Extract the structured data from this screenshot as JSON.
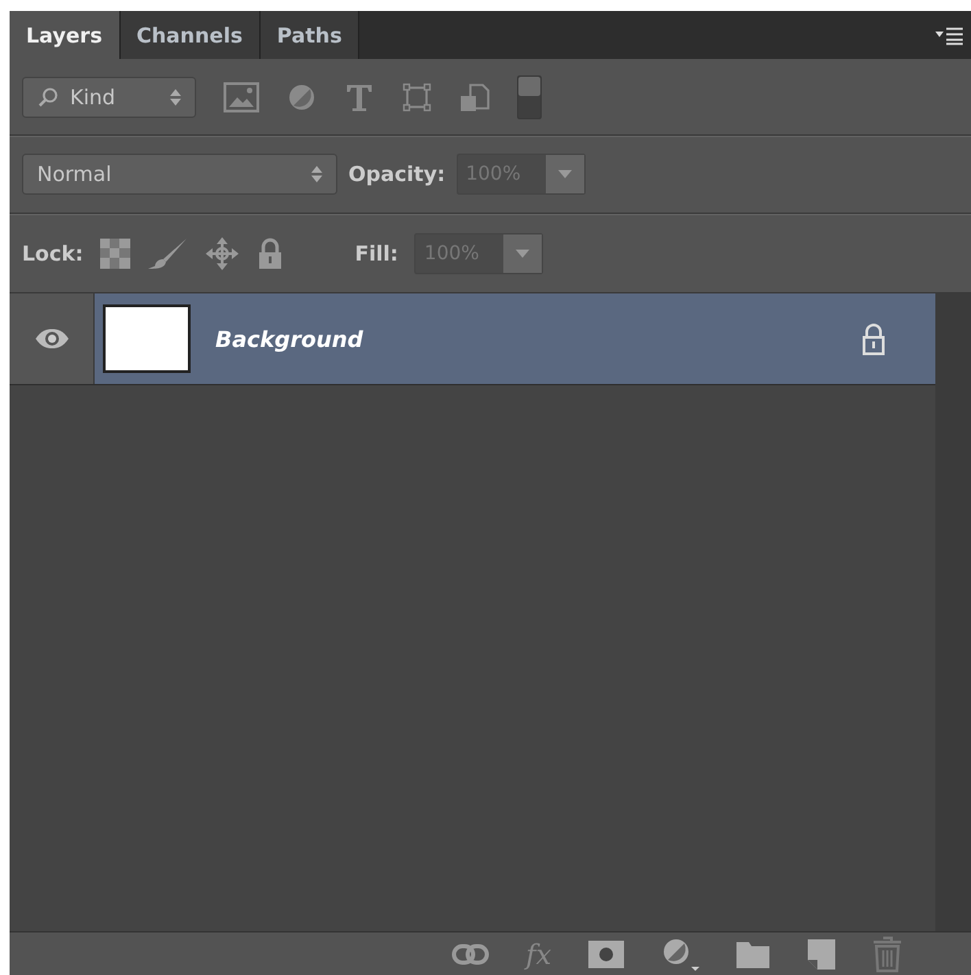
{
  "tabs": [
    {
      "label": "Layers",
      "selected": true
    },
    {
      "label": "Channels",
      "selected": false
    },
    {
      "label": "Paths",
      "selected": false
    }
  ],
  "filter": {
    "value": "Kind",
    "filter_on": false
  },
  "blend": {
    "mode": "Normal",
    "opacity_label": "Opacity:",
    "opacity": "100%"
  },
  "lock": {
    "label": "Lock:",
    "fill_label": "Fill:",
    "fill": "100%"
  },
  "layers": [
    {
      "name": "Background",
      "visible": true,
      "selected": true,
      "locked": true
    }
  ],
  "footer": {
    "fx": "fx"
  }
}
